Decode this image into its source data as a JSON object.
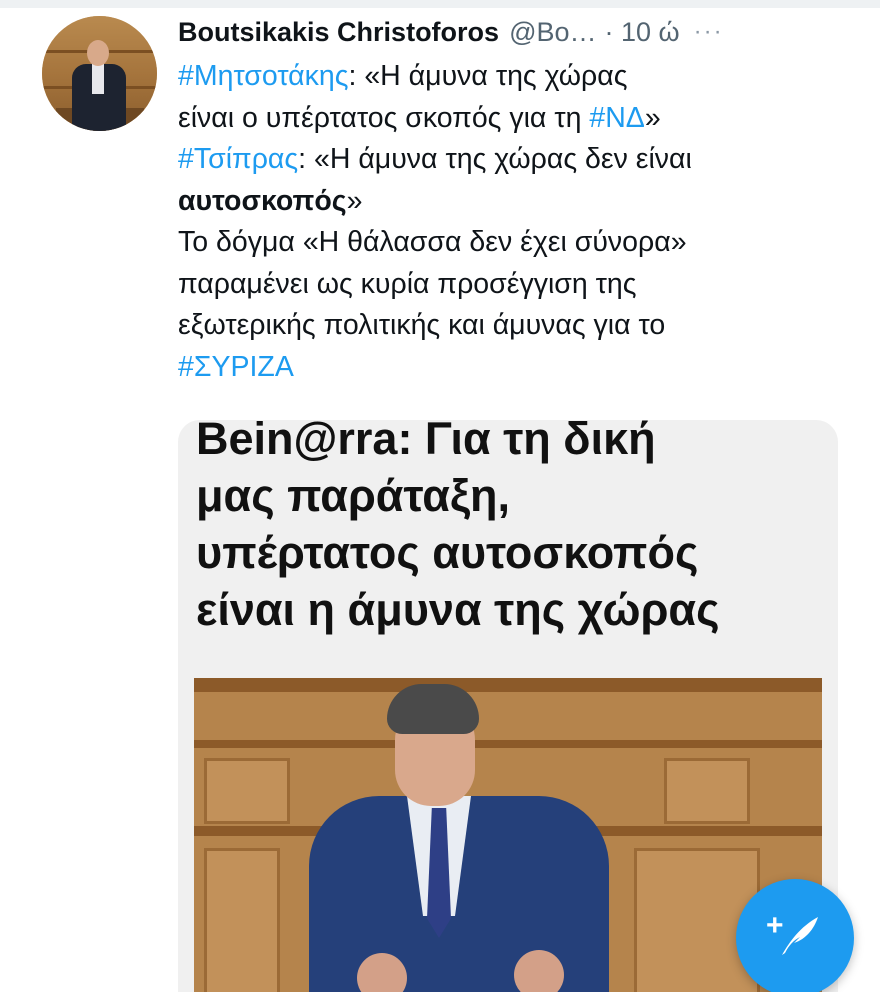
{
  "tweet": {
    "author_name": "Boutsikakis Christoforos",
    "author_handle": "@Bo…",
    "time": "· 10 ώ",
    "more_icon": "more-horizontal-icon",
    "lines": {
      "l1_hashtag": "#Μητσοτάκης",
      "l1_text": ": «Η άμυνα της χώρας",
      "l2_text": "είναι ο υπέρτατος σκοπός για τη ",
      "l2_hashtag": "#ΝΔ",
      "l2_end": "»",
      "l3_hashtag": "#Τσίπρας",
      "l3_text": ": «Η άμυνα της χώρας δεν είναι",
      "l4_bold": "αυτοσκοπός",
      "l4_end": "»",
      "l5_text": "Το δόγμα «Η θάλασσα δεν έχει σύνορα»",
      "l6_text": "παραμένει ως κυρία προσέγγιση της",
      "l7_text": "εξωτερικής πολιτικής και άμυνας για το",
      "l8_hashtag": "#ΣΥΡΙΖΑ"
    }
  },
  "card": {
    "headline_lines": [
      "Bein@rra: Για τη δική",
      "μας παράταξη,",
      "υπέρτατος αυτοσκοπός",
      "είναι η άμυνα της χώρας"
    ]
  },
  "fab": {
    "icon": "compose-tweet-icon",
    "plus": "+"
  },
  "colors": {
    "accent": "#1d9bf0",
    "text": "#0f1419",
    "secondary": "#536471"
  }
}
